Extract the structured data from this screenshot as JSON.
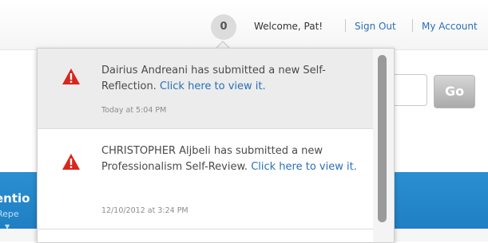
{
  "header": {
    "notification_count": "0",
    "welcome_text": "Welcome, Pat!",
    "sign_out_label": "Sign Out",
    "my_account_label": "My Account"
  },
  "search": {
    "value": "",
    "go_label": "Go"
  },
  "band": {
    "title_fragment": "entio",
    "subtitle_fragment": "Repe"
  },
  "notifications": [
    {
      "message": "Dairius Andreani has submitted a new Self-Reflection.",
      "link_text": "Click here to view it.",
      "time": "Today at 5:04 PM",
      "icon": "warning-icon"
    },
    {
      "message": "CHRISTOPHER Aljbeli has submitted a new Professionalism Self-Review.",
      "link_text": "Click here to view it.",
      "time": "12/10/2012 at 3:24 PM",
      "icon": "warning-icon"
    }
  ],
  "colors": {
    "link": "#2a6fb4",
    "warning": "#d9261c",
    "band": "#2b8fd2",
    "highlight": "#ececec"
  }
}
